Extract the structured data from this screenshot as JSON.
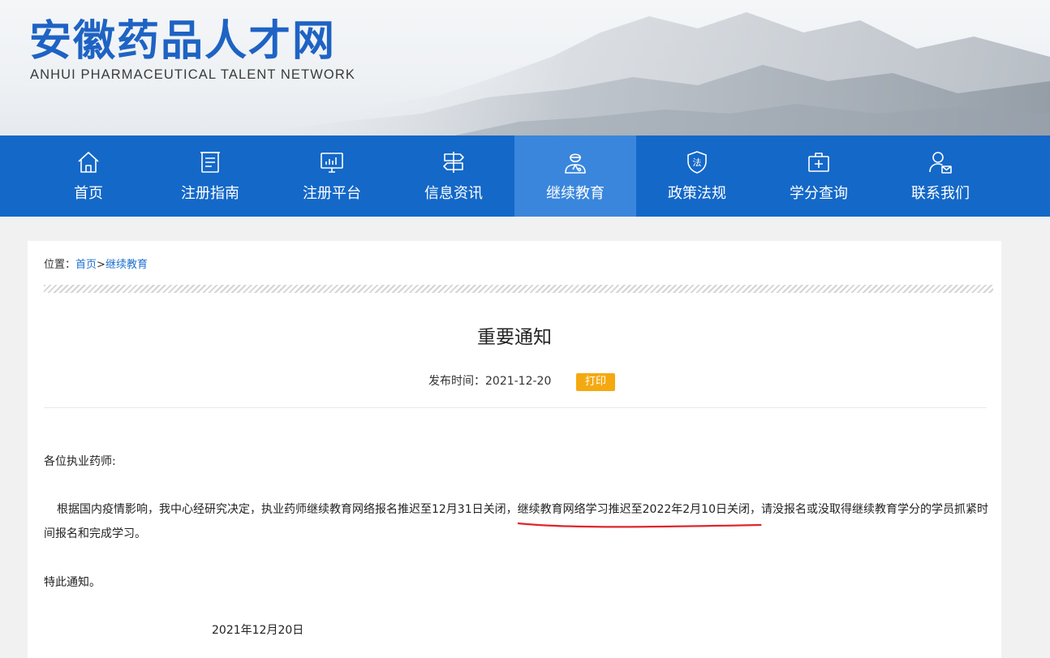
{
  "header": {
    "logo_cn": "安徽药品人才网",
    "logo_en": "ANHUI PHARMACEUTICAL TALENT NETWORK"
  },
  "nav": {
    "items": [
      {
        "label": "首页",
        "icon": "home-icon"
      },
      {
        "label": "注册指南",
        "icon": "document-icon"
      },
      {
        "label": "注册平台",
        "icon": "monitor-chart-icon"
      },
      {
        "label": "信息资讯",
        "icon": "signpost-icon"
      },
      {
        "label": "继续教育",
        "icon": "doctor-icon",
        "active": true
      },
      {
        "label": "政策法规",
        "icon": "law-shield-icon"
      },
      {
        "label": "学分查询",
        "icon": "medical-kit-icon"
      },
      {
        "label": "联系我们",
        "icon": "contact-user-icon"
      }
    ]
  },
  "breadcrumb": {
    "prefix": "位置：",
    "home": "首页",
    "sep": ">",
    "current": "继续教育"
  },
  "article": {
    "title": "重要通知",
    "meta_label": "发布时间：",
    "date": "2021-12-20",
    "print_label": "打印",
    "greeting": "各位执业药师:",
    "body_part1": "根据国内疫情影响，我中心经研究决定，执业药师继续教育网络报名推迟至12月31日关闭，",
    "body_highlight": "继续教育网络学习推迟至2022年2月10日关闭，",
    "body_part2": "请没报名或没取得继续教育学分的学员抓紧时间报名和完成学习。",
    "closing": "特此通知。",
    "sign_date": "2021年12月20日"
  },
  "colors": {
    "brand_blue": "#1468c8",
    "nav_active": "#3a86dd",
    "print_orange": "#f5a911",
    "annotation_red": "#e0262b"
  }
}
